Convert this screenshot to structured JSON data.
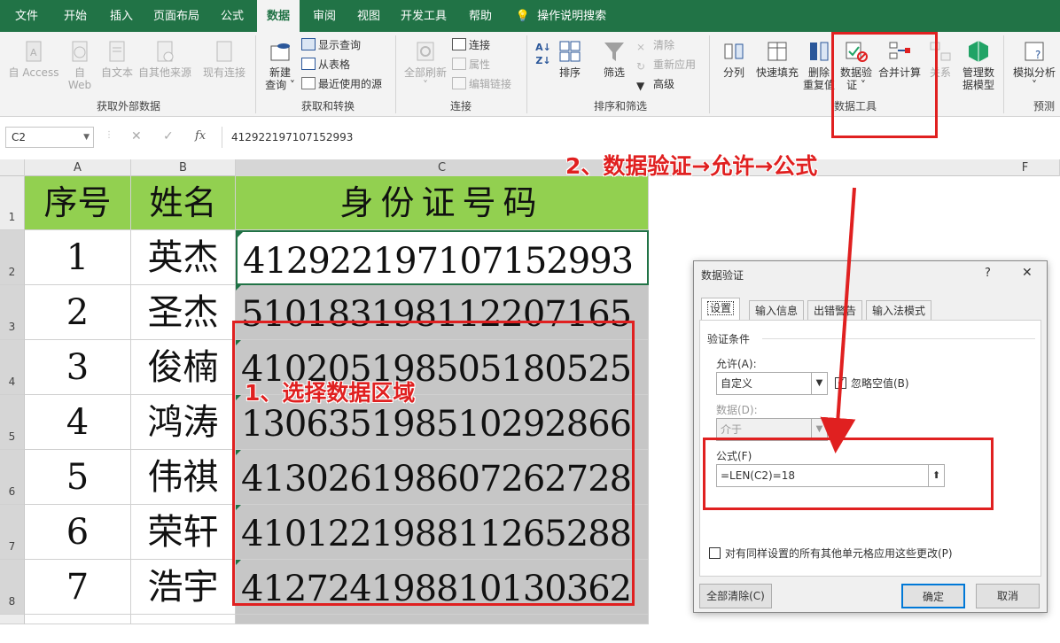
{
  "ribbon_tabs": [
    "文件",
    "开始",
    "插入",
    "页面布局",
    "公式",
    "数据",
    "审阅",
    "视图",
    "开发工具",
    "帮助",
    "操作说明搜索"
  ],
  "active_tab": "数据",
  "groups": {
    "external": {
      "label": "获取外部数据",
      "access": "自 Access",
      "web_1": "自",
      "web_2": "Web",
      "text": "自文本",
      "other": "自其他来源",
      "existing": "现有连接"
    },
    "transform": {
      "label": "获取和转换",
      "new_query_1": "新建",
      "new_query_2": "查询",
      "show_query": "显示查询",
      "from_table": "从表格",
      "recent": "最近使用的源"
    },
    "connections": {
      "label": "连接",
      "refresh_all": "全部刷新",
      "connections": "连接",
      "properties": "属性",
      "edit_links": "编辑链接"
    },
    "sort_filter": {
      "label": "排序和筛选",
      "sort": "排序",
      "filter": "筛选",
      "clear": "清除",
      "reapply": "重新应用",
      "advanced": "高级"
    },
    "data_tools": {
      "label": "数据工具",
      "split": "分列",
      "flash_fill": "快速填充",
      "remove_dup_1": "删除",
      "remove_dup_2": "重复值",
      "validation_1": "数据验",
      "validation_2": "证",
      "consolidate": "合并计算",
      "relations": "关系",
      "data_model_1": "管理数",
      "data_model_2": "据模型"
    },
    "forecast": {
      "label": "预测",
      "what_if": "模拟分析"
    }
  },
  "formula_bar": {
    "name_box": "C2",
    "fx": "fx",
    "value": "412922197107152993"
  },
  "columns": [
    "A",
    "B",
    "C",
    "F"
  ],
  "rows": [
    "1",
    "2",
    "3",
    "4",
    "5",
    "6",
    "7",
    "8"
  ],
  "table": {
    "headers": [
      "序号",
      "姓名",
      "身份证号码"
    ],
    "data": [
      [
        "1",
        "英杰",
        "412922197107152993"
      ],
      [
        "2",
        "圣杰",
        "510183198112207165"
      ],
      [
        "3",
        "俊楠",
        "410205198505180525"
      ],
      [
        "4",
        "鸿涛",
        "130635198510292866"
      ],
      [
        "5",
        "伟祺",
        "413026198607262728"
      ],
      [
        "6",
        "荣轩",
        "410122198811265288"
      ],
      [
        "7",
        "浩宇",
        "412724198810130362"
      ]
    ]
  },
  "annotations": {
    "step1": "1、选择数据区域",
    "step2": "2、数据验证→允许→公式"
  },
  "dialog": {
    "title": "数据验证",
    "help": "?",
    "close": "✕",
    "tabs": [
      "设置",
      "输入信息",
      "出错警告",
      "输入法模式"
    ],
    "section": "验证条件",
    "allow_label": "允许(A):",
    "allow_value": "自定义",
    "ignore_blank": "忽略空值(B)",
    "data_label": "数据(D):",
    "data_value": "介于",
    "formula_label": "公式(F)",
    "formula_value": "=LEN(C2)=18",
    "apply_all": "对有同样设置的所有其他单元格应用这些更改(P)",
    "clear_all": "全部清除(C)",
    "ok": "确定",
    "cancel": "取消"
  },
  "colors": {
    "excel_green": "#217346",
    "header_fill": "#92d050",
    "annotation_red": "#e02020",
    "selection_gray": "#c6c6c6"
  }
}
